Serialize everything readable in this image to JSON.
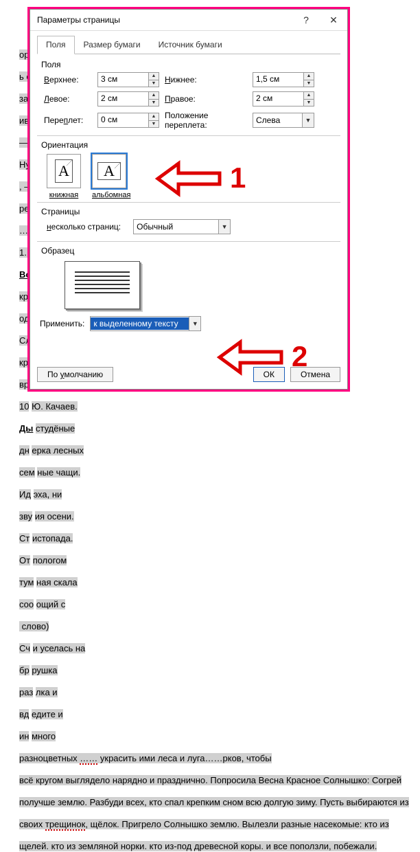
{
  "dialog": {
    "title": "Параметры страницы",
    "tabs": [
      "Поля",
      "Размер бумаги",
      "Источник бумаги"
    ],
    "group_fields_title": "Поля",
    "fields": {
      "top_label": "Верхнее:",
      "top_value": "3 см",
      "bottom_label": "Нижнее:",
      "bottom_value": "1,5 см",
      "left_label": "Левое:",
      "left_value": "2 см",
      "right_label": "Правое:",
      "right_value": "2 см",
      "gutter_label": "Переплет:",
      "gutter_value": "0 см",
      "gutter_pos_label": "Положение переплета:",
      "gutter_pos_value": "Слева"
    },
    "orientation": {
      "title": "Ориентация",
      "portrait": "книжная",
      "landscape": "альбомная",
      "selected": "landscape"
    },
    "pages_section": {
      "title": "Страницы",
      "multipage_label": "несколько страниц:",
      "multipage_value": "Обычный"
    },
    "preview_title": "Образец",
    "apply": {
      "label": "Применить:",
      "value": "к выделенному тексту"
    },
    "default_button": "По умолчанию",
    "ok_button": "ОК",
    "cancel_button": "Отмена"
  },
  "annotations": {
    "num1": "1",
    "num2": "2"
  },
  "background_text": "…орошенькие, ь её с ружья, за ней не …ивет она — Я в то Ну как вы , — перебил ре же вы … — И ты их 1. Пришвин. Во… уж как кри… унесли одителей. Сл… одки рядом кру… отрели, и вре… о, что чуть 10… Ю. Качаев. Ды… студёные дн… ерка лесных сем… ные чащи. Ид… эха, ни зву… ия осени. Ст… истопада. От… пологом тум… ная скала соо… ощий с слово) Сч… и уселась на бр… рушка раз… лка и вд… едите и ин… много\nразноцветных …… украсить ими леса и луга…….рков, чтобы всё кругом выглядело нарядно и празднично. Попросила Весна Красное Солнышко: Согрей получше землю. Разбуди всех, кто спал крепким сном всю долгую зиму. Пусть выбираются из своих трещинок, щёлок. Пригрело Солнышко землю. Вылезли разные насекомые: кто из щелей. кто из земляной норки. кто из-под древесной коры. и все поползли, побежали."
}
